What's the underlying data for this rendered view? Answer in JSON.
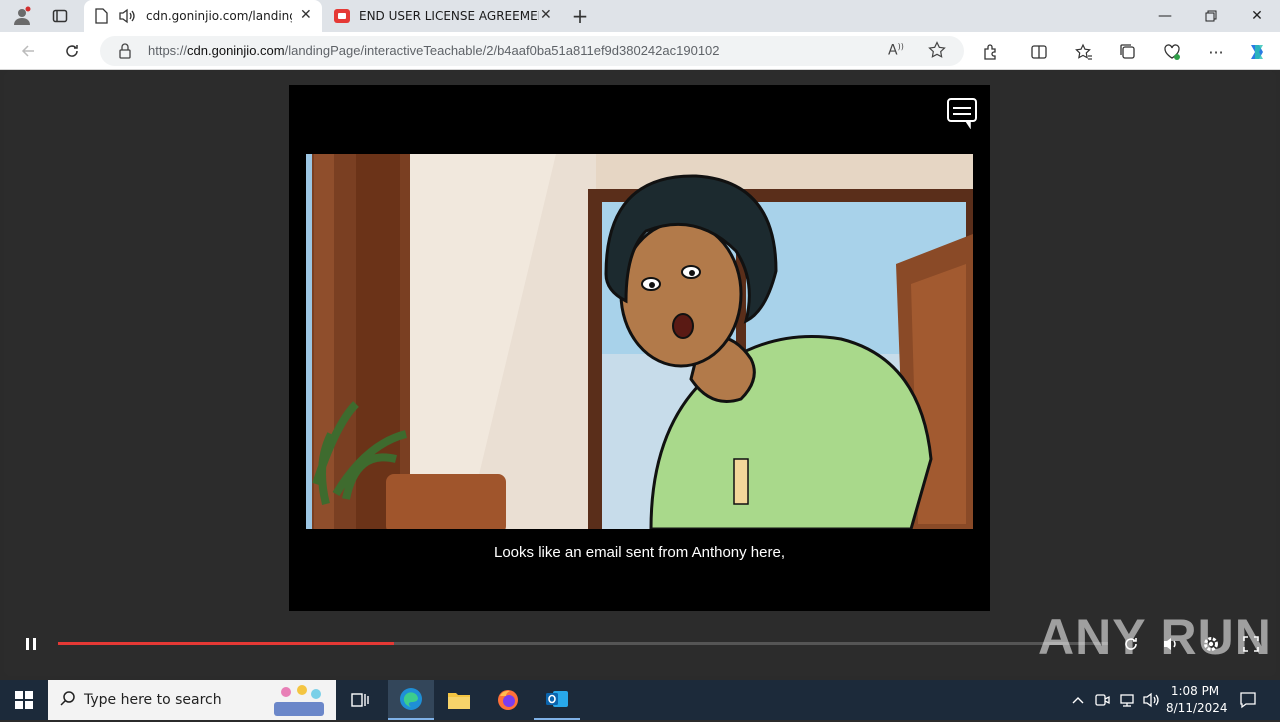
{
  "browser": {
    "tabs": [
      {
        "label": "cdn.goninjio.com/landingP",
        "active": true
      },
      {
        "label": "END USER LICENSE AGREEMENT",
        "active": false
      }
    ],
    "url_scheme": "https://",
    "url_host": "cdn.goninjio.com",
    "url_path": "/landingPage/interactiveTeachable/2/b4aaf0ba51a811ef9d380242ac190102"
  },
  "player": {
    "caption": "Looks like an email sent from Anthony here,",
    "progress": 0.32,
    "accent_color": "#e53935"
  },
  "watermark": "ANY RUN",
  "taskbar": {
    "search_placeholder": "Type here to search",
    "time": "1:08 PM",
    "date": "8/11/2024"
  }
}
